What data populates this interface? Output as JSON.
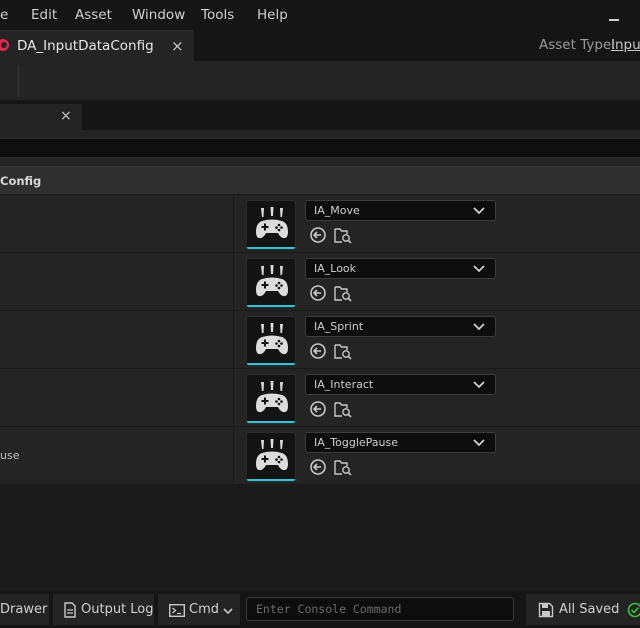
{
  "menubar": {
    "items": [
      "e",
      "Edit",
      "Asset",
      "Window",
      "Tools",
      "Help"
    ]
  },
  "tab": {
    "title": "DA_InputDataConfig",
    "close": "×"
  },
  "asset_type": {
    "label": "Asset Type:",
    "value": "Input"
  },
  "panel_tab": {
    "close": "×"
  },
  "category": {
    "label": "Config"
  },
  "rows": [
    {
      "name": "",
      "value": "IA_Move"
    },
    {
      "name": "",
      "value": "IA_Look"
    },
    {
      "name": "",
      "value": "IA_Sprint"
    },
    {
      "name": "",
      "value": "IA_Interact"
    },
    {
      "name": "use",
      "value": "IA_TogglePause"
    }
  ],
  "statusbar": {
    "drawer": "Drawer",
    "output_log": "Output Log",
    "cmd": "Cmd",
    "console_placeholder": "Enter Console Command",
    "all_saved": "All Saved"
  },
  "colors": {
    "accent_thumb_bar": "#2fc4d6",
    "asset_icon": "#e0284d",
    "saved_check": "#3fbf3f"
  },
  "icons": {
    "thumbnail": "gamepad-icon",
    "browse": "arrow-left-circle-icon",
    "find": "folder-search-icon"
  }
}
